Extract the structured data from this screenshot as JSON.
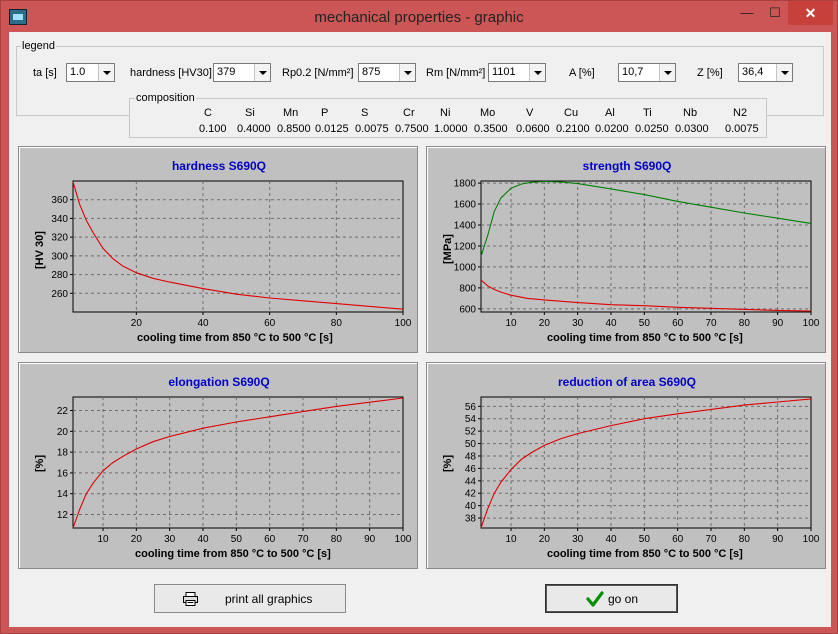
{
  "window": {
    "title": "mechanical properties - graphic"
  },
  "legend": {
    "title": "legend",
    "fields": [
      {
        "label": "ta [s]",
        "value": "1.0"
      },
      {
        "label": "hardness [HV30]",
        "value": "379"
      },
      {
        "label": "Rp0.2 [N/mm²]",
        "value": "875"
      },
      {
        "label": "Rm [N/mm²]",
        "value": "1101"
      },
      {
        "label": "A [%]",
        "value": "10,7"
      },
      {
        "label": "Z [%]",
        "value": "36,4"
      }
    ]
  },
  "composition": {
    "title": "composition",
    "elements": [
      {
        "name": "C",
        "value": "0.100"
      },
      {
        "name": "Si",
        "value": "0.4000"
      },
      {
        "name": "Mn",
        "value": "0.8500"
      },
      {
        "name": "P",
        "value": "0.0125"
      },
      {
        "name": "S",
        "value": "0.0075"
      },
      {
        "name": "Cr",
        "value": "0.7500"
      },
      {
        "name": "Ni",
        "value": "1.0000"
      },
      {
        "name": "Mo",
        "value": "0.3500"
      },
      {
        "name": "V",
        "value": "0.0600"
      },
      {
        "name": "Cu",
        "value": "0.2100"
      },
      {
        "name": "Al",
        "value": "0.0200"
      },
      {
        "name": "Ti",
        "value": "0.0250"
      },
      {
        "name": "Nb",
        "value": "0.0300"
      },
      {
        "name": "N2",
        "value": "0.0075"
      }
    ]
  },
  "colors": {
    "title": "#0000c8",
    "curve_red": "#e00000",
    "curve_green": "#008000",
    "plot_bg": "#c0c0c0"
  },
  "chart_data": [
    {
      "type": "line",
      "title": "hardness  S690Q",
      "xlabel": "cooling time from 850 °C to 500 °C [s]",
      "ylabel": "[HV 30]",
      "xlim": [
        1,
        100
      ],
      "ylim": [
        240,
        380
      ],
      "xticks": [
        20,
        40,
        60,
        80,
        100
      ],
      "yticks": [
        260,
        280,
        300,
        320,
        340,
        360
      ],
      "grid": true,
      "series": [
        {
          "color": "#e00000",
          "x": [
            1,
            3,
            5,
            7,
            10,
            13,
            16,
            20,
            25,
            30,
            40,
            50,
            60,
            70,
            80,
            90,
            100
          ],
          "y": [
            379,
            355,
            338,
            325,
            308,
            297,
            289,
            282,
            276,
            272,
            265,
            259,
            255,
            252,
            249,
            246,
            243
          ]
        }
      ]
    },
    {
      "type": "line",
      "title": "strength  S690Q",
      "xlabel": "cooling time from 850 °C to 500 °C [s]",
      "ylabel": "[MPa]",
      "xlim": [
        1,
        100
      ],
      "ylim": [
        570,
        1820
      ],
      "xticks": [
        10,
        20,
        30,
        40,
        50,
        60,
        70,
        80,
        90,
        100
      ],
      "yticks": [
        600,
        800,
        1000,
        1200,
        1400,
        1600,
        1800
      ],
      "grid": true,
      "series": [
        {
          "color": "#008000",
          "x": [
            1,
            3,
            5,
            7,
            10,
            13,
            16,
            20,
            25,
            30,
            40,
            50,
            60,
            70,
            80,
            90,
            100
          ],
          "y": [
            1101,
            1300,
            1530,
            1660,
            1750,
            1790,
            1808,
            1815,
            1810,
            1795,
            1745,
            1690,
            1625,
            1570,
            1515,
            1465,
            1415
          ]
        },
        {
          "color": "#e00000",
          "x": [
            1,
            3,
            5,
            7,
            10,
            15,
            20,
            30,
            40,
            50,
            60,
            70,
            80,
            90,
            100
          ],
          "y": [
            875,
            820,
            785,
            760,
            730,
            700,
            685,
            660,
            640,
            630,
            615,
            605,
            595,
            585,
            580
          ]
        }
      ]
    },
    {
      "type": "line",
      "title": "elongation  S690Q",
      "xlabel": "cooling time from 850 °C to 500 °C [s]",
      "ylabel": "[%]",
      "xlim": [
        1,
        100
      ],
      "ylim": [
        10.7,
        23.3
      ],
      "xticks": [
        10,
        20,
        30,
        40,
        50,
        60,
        70,
        80,
        90,
        100
      ],
      "yticks": [
        12,
        14,
        16,
        18,
        20,
        22
      ],
      "grid": true,
      "series": [
        {
          "color": "#e00000",
          "x": [
            1,
            3,
            5,
            7,
            10,
            13,
            16,
            20,
            25,
            30,
            40,
            50,
            60,
            70,
            80,
            90,
            100
          ],
          "y": [
            10.7,
            12.5,
            14.0,
            15.0,
            16.2,
            17.0,
            17.6,
            18.3,
            19.0,
            19.5,
            20.3,
            20.9,
            21.4,
            21.9,
            22.4,
            22.8,
            23.2
          ]
        }
      ]
    },
    {
      "type": "line",
      "title": "reduction of area  S690Q",
      "xlabel": "cooling time from 850 °C to 500 °C [s]",
      "ylabel": "[%]",
      "xlim": [
        1,
        100
      ],
      "ylim": [
        36.4,
        57.5
      ],
      "xticks": [
        10,
        20,
        30,
        40,
        50,
        60,
        70,
        80,
        90,
        100
      ],
      "yticks": [
        38,
        40,
        42,
        44,
        46,
        48,
        50,
        52,
        54,
        56
      ],
      "grid": true,
      "series": [
        {
          "color": "#e00000",
          "x": [
            1,
            3,
            5,
            7,
            10,
            13,
            16,
            20,
            25,
            30,
            40,
            50,
            60,
            70,
            80,
            90,
            100
          ],
          "y": [
            36.4,
            39.5,
            42.0,
            43.8,
            45.8,
            47.4,
            48.5,
            49.7,
            50.8,
            51.6,
            52.9,
            54.0,
            54.8,
            55.5,
            56.2,
            56.7,
            57.2
          ]
        }
      ]
    }
  ],
  "buttons": {
    "print": "print all graphics",
    "go_on": "go on"
  }
}
